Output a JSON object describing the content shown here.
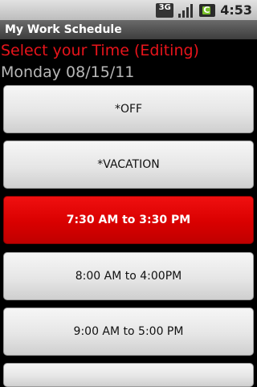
{
  "status_bar": {
    "network": "3G",
    "signal_icon": "signal-bars-icon",
    "battery_icon": "battery-charging-icon",
    "time": "4:53"
  },
  "title_bar": {
    "title": "My Work Schedule"
  },
  "subtitle": "Select your Time (Editing)",
  "date": "Monday 08/15/11",
  "options": [
    {
      "label": "*OFF",
      "selected": false
    },
    {
      "label": "*VACATION",
      "selected": false
    },
    {
      "label": "7:30 AM to 3:30 PM",
      "selected": true
    },
    {
      "label": "8:00 AM to 4:00PM",
      "selected": false
    },
    {
      "label": "9:00 AM to 5:00 PM",
      "selected": false
    },
    {
      "label": "",
      "selected": false
    }
  ],
  "colors": {
    "accent_red": "#e8141b",
    "selected_button": "#d90000"
  }
}
